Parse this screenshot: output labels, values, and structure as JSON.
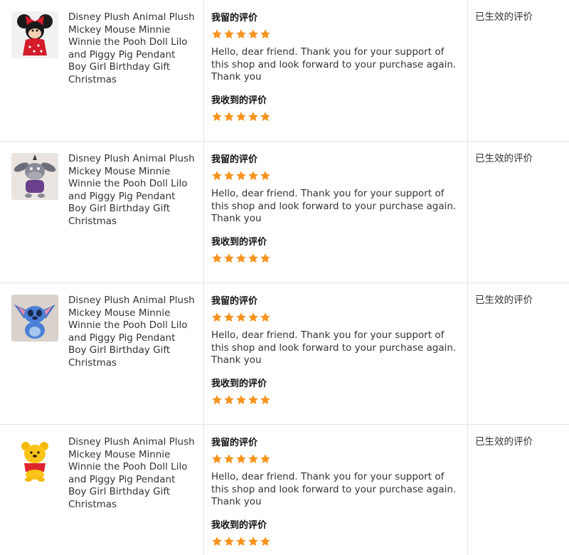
{
  "reviews": [
    {
      "product_title": "Disney Plush Animal Plush Mickey Mouse Minnie Winnie the Pooh Doll Lilo and Piggy Pig Pendant Boy Girl Birthday Gift Christmas",
      "thumbnail": "minnie-mouse-plush",
      "left_label": "我留的评价",
      "left_rating": 5,
      "left_text": "Hello, dear friend. Thank you for your support of this shop and look forward to your purchase again. Thank you",
      "received_label": "我收到的评价",
      "received_rating": 5,
      "status": "已生效的评价"
    },
    {
      "product_title": "Disney Plush Animal Plush Mickey Mouse Minnie Winnie the Pooh Doll Lilo and Piggy Pig Pendant Boy Girl Birthday Gift Christmas",
      "thumbnail": "eeyore-plush",
      "left_label": "我留的评价",
      "left_rating": 5,
      "left_text": "Hello, dear friend. Thank you for your support of this shop and look forward to your purchase again. Thank you",
      "received_label": "我收到的评价",
      "received_rating": 5,
      "status": "已生效的评价"
    },
    {
      "product_title": "Disney Plush Animal Plush Mickey Mouse Minnie Winnie the Pooh Doll Lilo and Piggy Pig Pendant Boy Girl Birthday Gift Christmas",
      "thumbnail": "stitch-plush",
      "left_label": "我留的评价",
      "left_rating": 5,
      "left_text": "Hello, dear friend. Thank you for your support of this shop and look forward to your purchase again. Thank you",
      "received_label": "我收到的评价",
      "received_rating": 5,
      "status": "已生效的评价"
    },
    {
      "product_title": "Disney Plush Animal Plush Mickey Mouse Minnie Winnie the Pooh Doll Lilo and Piggy Pig Pendant Boy Girl Birthday Gift Christmas",
      "thumbnail": "winnie-the-pooh-plush",
      "left_label": "我留的评价",
      "left_rating": 5,
      "left_text": "Hello, dear friend. Thank you for your support of this shop and look forward to your purchase again. Thank you",
      "received_label": "我收到的评价",
      "received_rating": 5,
      "status": "已生效的评价"
    }
  ],
  "colors": {
    "star": "#f7931e",
    "divider": "#e5e5e5",
    "text": "#333333"
  }
}
